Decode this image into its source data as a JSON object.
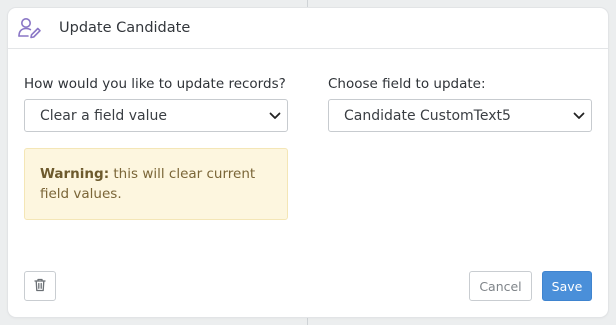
{
  "dialog": {
    "title": "Update Candidate",
    "icon": "user-edit-icon"
  },
  "form": {
    "update_method": {
      "label": "How would you like to update records?",
      "selected": "Clear a field value"
    },
    "field": {
      "label": "Choose field to update:",
      "selected": "Candidate CustomText5"
    },
    "warning": {
      "title": "Warning:",
      "text": "this will clear current field values."
    }
  },
  "footer": {
    "delete_icon": "trash-icon",
    "cancel_label": "Cancel",
    "save_label": "Save"
  },
  "colors": {
    "accent": "#4a8fd9",
    "icon_purple": "#8a76c6",
    "warning_bg": "#fdf6df"
  }
}
